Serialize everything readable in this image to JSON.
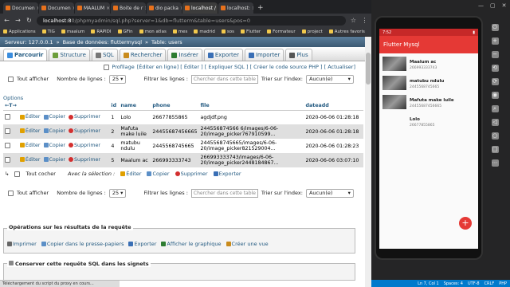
{
  "tabs": [
    {
      "label": "Documen"
    },
    {
      "label": "Documen"
    },
    {
      "label": "MAALUM"
    },
    {
      "label": "Boite de r"
    },
    {
      "label": "dio packa"
    },
    {
      "label": "localhost / ",
      "active": true
    },
    {
      "label": "localhost:"
    }
  ],
  "address": {
    "host": "localhost:8",
    "path": "0/phpmyadmin/sql.php?server=1&db=flutterm&table=users&pos=0"
  },
  "bookmarks": [
    "Applications",
    "TIG",
    "maalum",
    "RAPIDI",
    "GFin",
    "mon atlas",
    "mes",
    "madrid",
    "sos",
    "Flutter",
    "Formateur",
    "project",
    "Autres favoris"
  ],
  "breadcrumb": {
    "server": "Serveur: 127.0.0.1",
    "db": "Base de données: fluttermysql",
    "table": "Table: users"
  },
  "nav": [
    {
      "label": "Parcourir",
      "color": "#3a8dde"
    },
    {
      "label": "Structure",
      "color": "#6c9e3a"
    },
    {
      "label": "SQL",
      "color": "#777777"
    },
    {
      "label": "Rechercher",
      "color": "#c98b1c"
    },
    {
      "label": "Insérer",
      "color": "#2e7d32"
    },
    {
      "label": "Exporter",
      "color": "#3a6fb5"
    },
    {
      "label": "Importer",
      "color": "#3a6fb5"
    },
    {
      "label": "Plus",
      "color": "#555555"
    }
  ],
  "profil": {
    "label": "Profilage",
    "links": "[Éditer en ligne] [ Éditer ] [ Expliquer SQL ] [ Créer le code source PHP ] [ Actualiser]"
  },
  "filter": {
    "show_all": "Tout afficher",
    "rows_label": "Nombre de lignes :",
    "rows_value": "25",
    "filter_label": "Filtrer les lignes :",
    "filter_placeholder": "Chercher dans cette table",
    "sort_label": "Trier sur l'index:",
    "sort_value": "Aucun(e)"
  },
  "options_label": "Options",
  "table": {
    "headers": [
      "",
      "",
      "",
      "id",
      "name",
      "phone",
      "file",
      "dateadd"
    ],
    "actions": {
      "edit": "Éditer",
      "copy": "Copier",
      "delete": "Supprimer"
    },
    "rows": [
      {
        "id": "1",
        "name": "Lolo",
        "phone": "26677855865",
        "file": "agdjdf.png",
        "date": "2020-06-06 01:28:18"
      },
      {
        "id": "2",
        "name": "Mafuta make luile",
        "phone": "24455687456665",
        "file": "244556874566 6/images/6-06-20/image_picker767910599...",
        "date": "2020-06-06 01:28:18"
      },
      {
        "id": "4",
        "name": "matubu ndulu",
        "phone": "2445568745665",
        "file": "2445568745665/images/6-06-20/image_picker821529004...",
        "date": "2020-06-06 01:28:23"
      },
      {
        "id": "5",
        "name": "Maalum ac",
        "phone": "266993333743",
        "file": "266993333743/images/6-06-20/image_picker2448184867...",
        "date": "2020-06-06 03:07:10"
      }
    ]
  },
  "bulk": {
    "check_all": "Tout cocher",
    "with_selection": "Avec la sélection :",
    "edit": "Éditer",
    "copy": "Copier",
    "delete": "Supprimer",
    "export": "Exporter"
  },
  "ops": {
    "title": "Opérations sur les résultats de la requête",
    "items": [
      "Imprimer",
      "Copier dans le presse-papiers",
      "Exporter",
      "Afficher le graphique",
      "Créer une vue"
    ]
  },
  "saveq": {
    "title": "Conserver cette requête SQL dans les signets"
  },
  "status_text": "Téléchargement du script du proxy en cours...",
  "editor_status": [
    "Ln 7, Col 1",
    "Spaces: 4",
    "UTF-8",
    "CRLF",
    "PHP"
  ],
  "phone": {
    "time": "7:52",
    "title": "Flutter Mysql",
    "items": [
      {
        "name": "Maalum ac",
        "phone": "266993333743"
      },
      {
        "name": "matubu ndulu",
        "phone": "2445568745665"
      },
      {
        "name": "Mafuta make luile",
        "phone": "24455687456665"
      },
      {
        "name": "Lolo",
        "phone": "26677855865"
      }
    ],
    "fab": "+"
  }
}
